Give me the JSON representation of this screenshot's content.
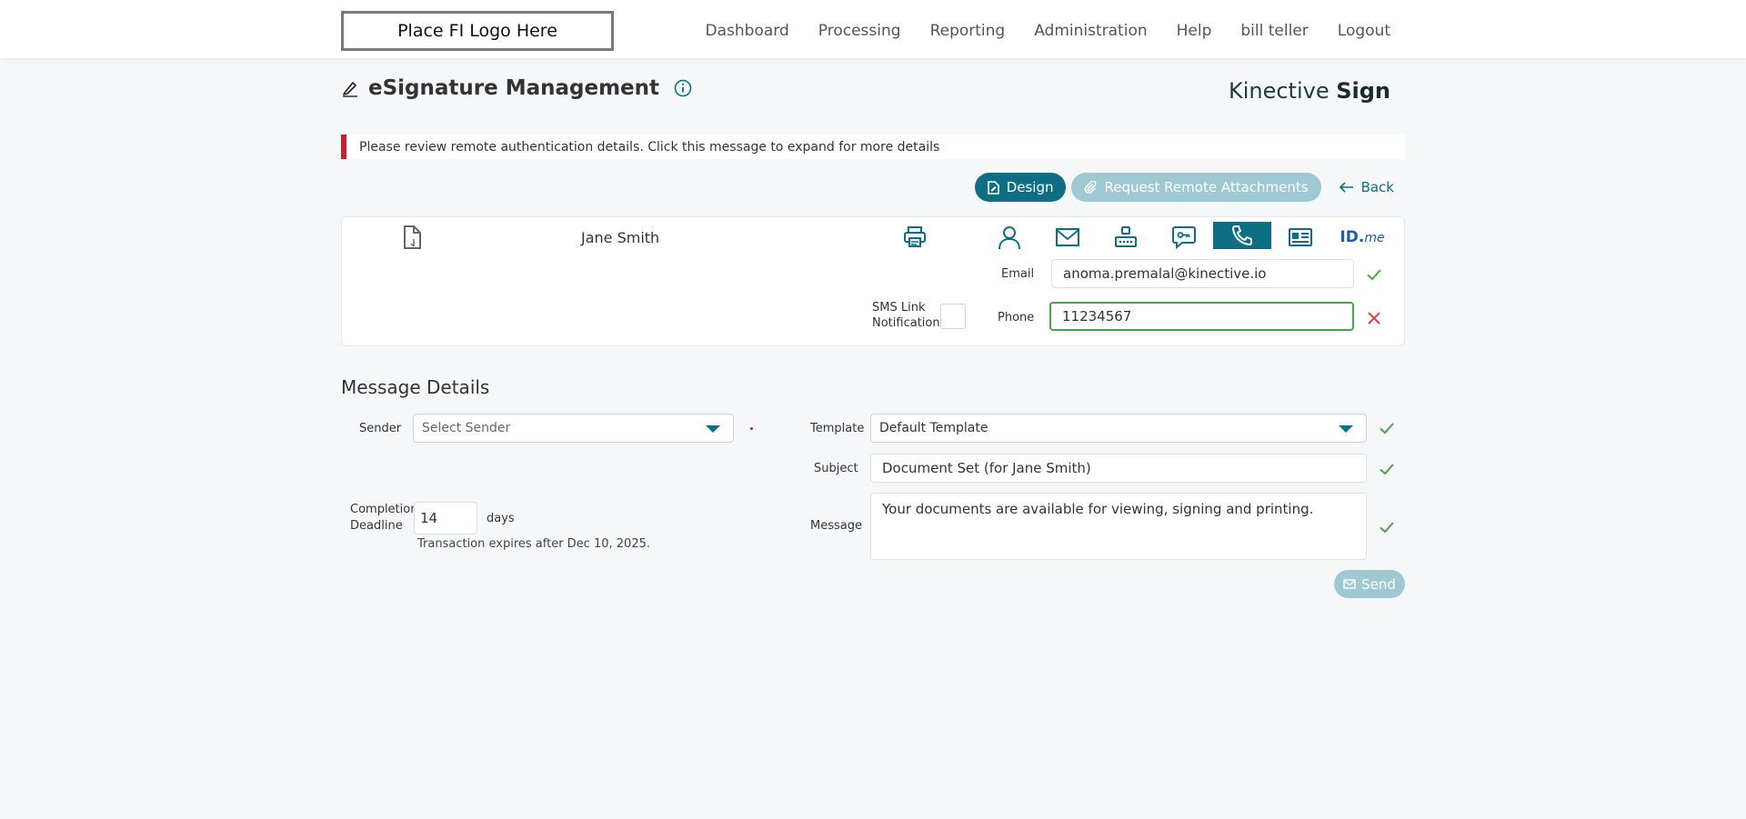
{
  "header": {
    "logo_text": "Place FI Logo Here",
    "nav": [
      "Dashboard",
      "Processing",
      "Reporting",
      "Administration",
      "Help",
      "bill teller",
      "Logout"
    ]
  },
  "page": {
    "title": "eSignature Management",
    "brand_light": "Kinective",
    "brand_bold": "Sign"
  },
  "alert": {
    "message": "Please review remote authentication details. Click this message to expand for more details"
  },
  "actions": {
    "design": "Design",
    "request": "Request Remote Attachments",
    "back": "Back"
  },
  "signer": {
    "name": "Jane Smith",
    "auth_icons": [
      "printer-icon",
      "person-icon",
      "mail-icon",
      "router-icon",
      "chat-key-icon",
      "phone-icon",
      "id-card-icon",
      "idme-icon"
    ],
    "active_icon": "phone-icon",
    "idme_text_a": "ID.",
    "idme_text_b": "me",
    "email_label": "Email",
    "email_value": "anoma.premalal@kinective.io",
    "phone_label": "Phone",
    "phone_value": "11234567",
    "sms_label_line1": "SMS Link",
    "sms_label_line2": "Notification"
  },
  "message_details": {
    "title": "Message Details",
    "sender_label": "Sender",
    "sender_placeholder": "Select Sender",
    "template_label": "Template",
    "template_value": "Default Template",
    "subject_label": "Subject",
    "subject_value": "Document Set (for Jane Smith)",
    "message_label": "Message",
    "message_value": "Your documents are available for viewing, signing and printing.",
    "deadline_label_line1": "Completion",
    "deadline_label_line2": "Deadline",
    "deadline_value": "14",
    "deadline_unit": "days",
    "expiry_note": "Transaction expires after Dec 10, 2025.",
    "send": "Send"
  },
  "colors": {
    "accent": "#0e6f84",
    "accent_disabled": "#9ec8d2",
    "alert_red": "#c8202f",
    "valid_green": "#4aa34a",
    "error_red": "#d64545"
  }
}
